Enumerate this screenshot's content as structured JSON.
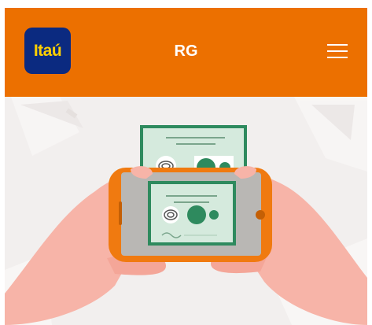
{
  "header": {
    "logo_text": "Itaú",
    "title": "RG",
    "menu_icon": "hamburger-menu-icon"
  },
  "hero": {
    "illustration": "hands-holding-phone-photographing-id-card",
    "colors": {
      "header_bg": "#ec7000",
      "logo_bg": "#0b2a80",
      "logo_text": "#ffd000",
      "phone": "#f07a10",
      "card_green": "#2b8a5e",
      "skin": "#f7b4a8"
    }
  }
}
